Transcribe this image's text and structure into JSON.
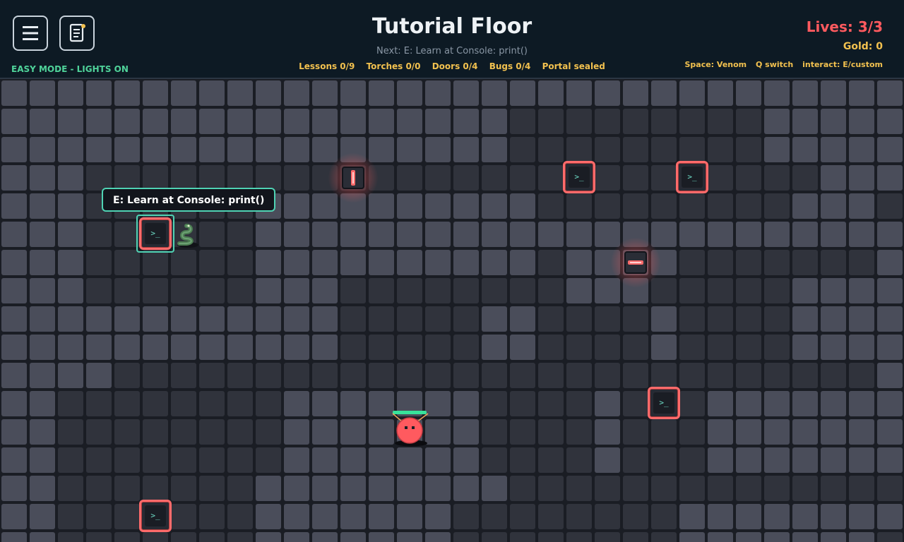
{
  "hud": {
    "title": "Tutorial Floor",
    "next_hint": "Next: E: Learn at Console: print()",
    "mode": "EASY MODE - LIGHTS ON",
    "lives": "Lives: 3/3",
    "gold": "Gold: 0",
    "stats": [
      "Lessons 0/9",
      "Torches 0/0",
      "Doors 0/4",
      "Bugs 0/4",
      "Portal sealed"
    ],
    "controls": [
      "Space: Venom",
      "Q switch",
      "interact: E/custom"
    ],
    "menu_icon": "hamburger-menu-icon",
    "notes_icon": "notebook-icon"
  },
  "prompt": "E: Learn at Console: print()",
  "console_glyph": ">_",
  "colors": {
    "hud_bg": "#0d1a24",
    "floor": "#4a4d5a",
    "dark_floor": "#30333c",
    "lives": "#ff5a5f",
    "stat": "#f2c14f",
    "easy_mode": "#4fd39a",
    "console_border": "#ff6b6b",
    "prompt_border": "#4fd3b4"
  }
}
